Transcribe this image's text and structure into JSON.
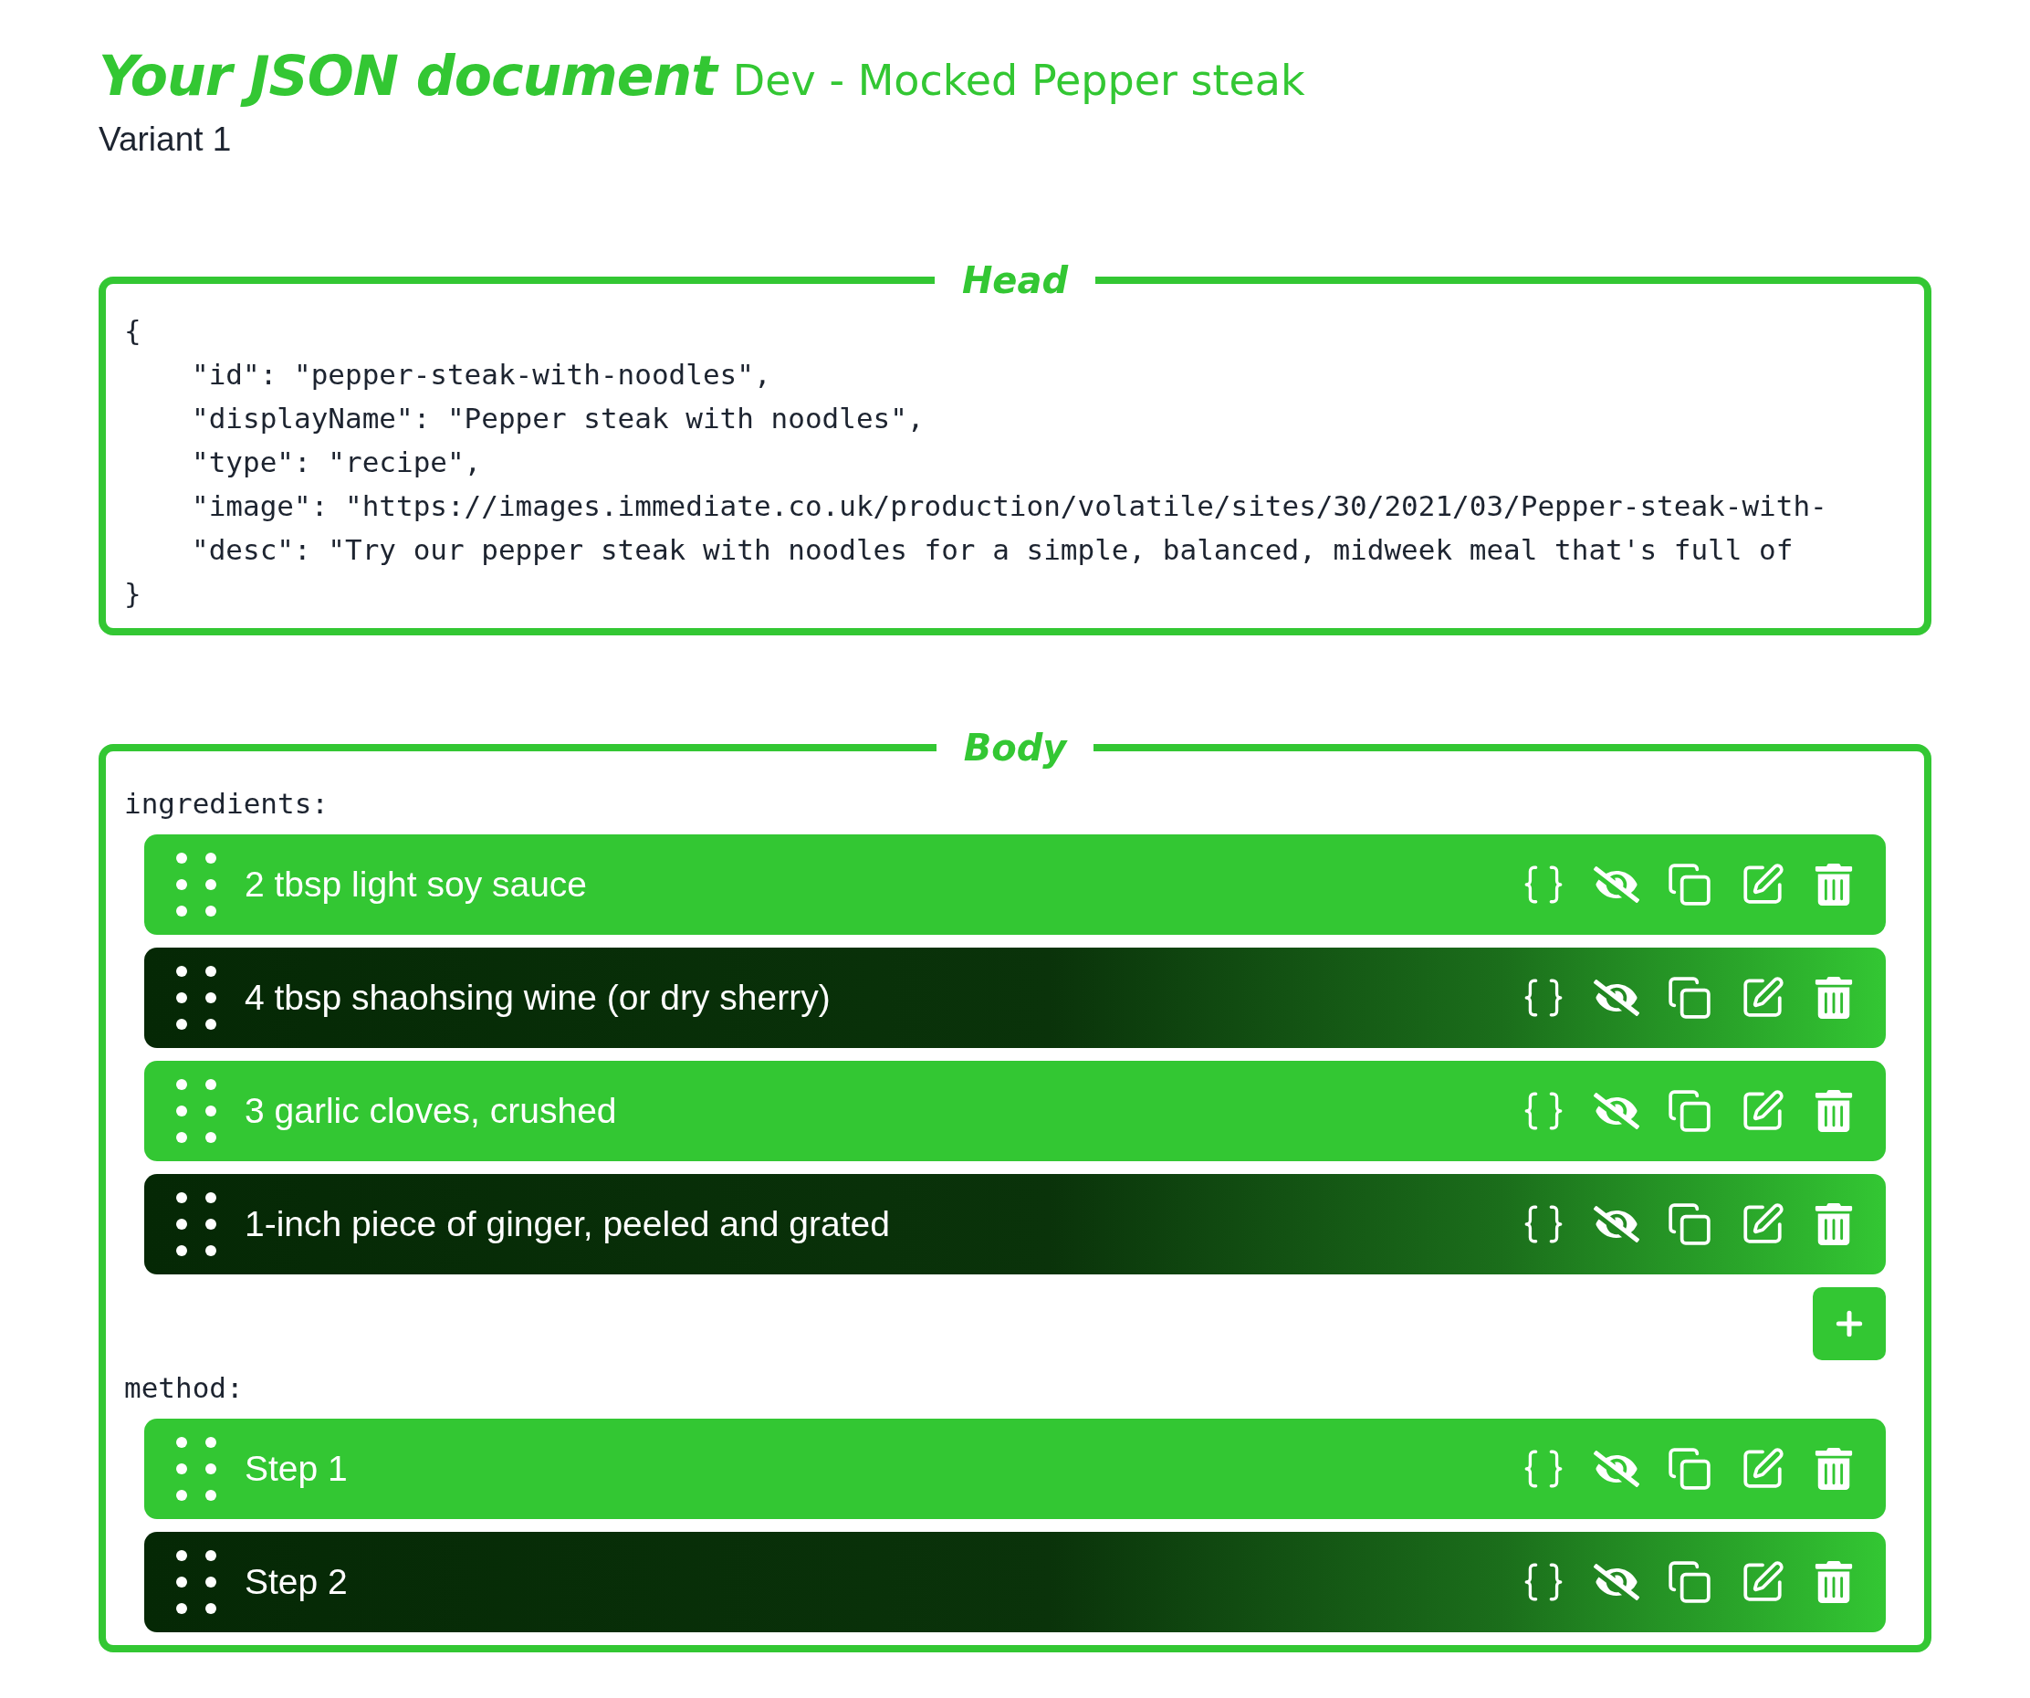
{
  "header": {
    "title": "Your JSON document",
    "subtitle": "Dev - Mocked Pepper steak",
    "variant": "Variant 1"
  },
  "head": {
    "legend": "Head",
    "lines": [
      {
        "kind": "brace",
        "text": "{"
      },
      {
        "kind": "entry",
        "text": "\"id\": \"pepper-steak-with-noodles\","
      },
      {
        "kind": "entry",
        "text": "\"displayName\": \"Pepper steak with noodles\","
      },
      {
        "kind": "entry",
        "text": "\"type\": \"recipe\","
      },
      {
        "kind": "entry",
        "text": "\"image\": \"https://images.immediate.co.uk/production/volatile/sites/30/2021/03/Pepper-steak-with-"
      },
      {
        "kind": "entry",
        "text": "\"desc\": \"Try our pepper steak with noodles for a simple, balanced, midweek meal that's full of"
      },
      {
        "kind": "brace",
        "text": "}"
      }
    ]
  },
  "body": {
    "legend": "Body",
    "sections": [
      {
        "label": "ingredients:",
        "items": [
          "2 tbsp light soy sauce",
          "4 tbsp shaohsing wine (or dry sherry)",
          "3 garlic cloves, crushed",
          "1-inch piece of ginger, peeled and grated"
        ],
        "add_button": true
      },
      {
        "label": "method:",
        "items": [
          "Step 1",
          "Step 2"
        ]
      }
    ]
  }
}
